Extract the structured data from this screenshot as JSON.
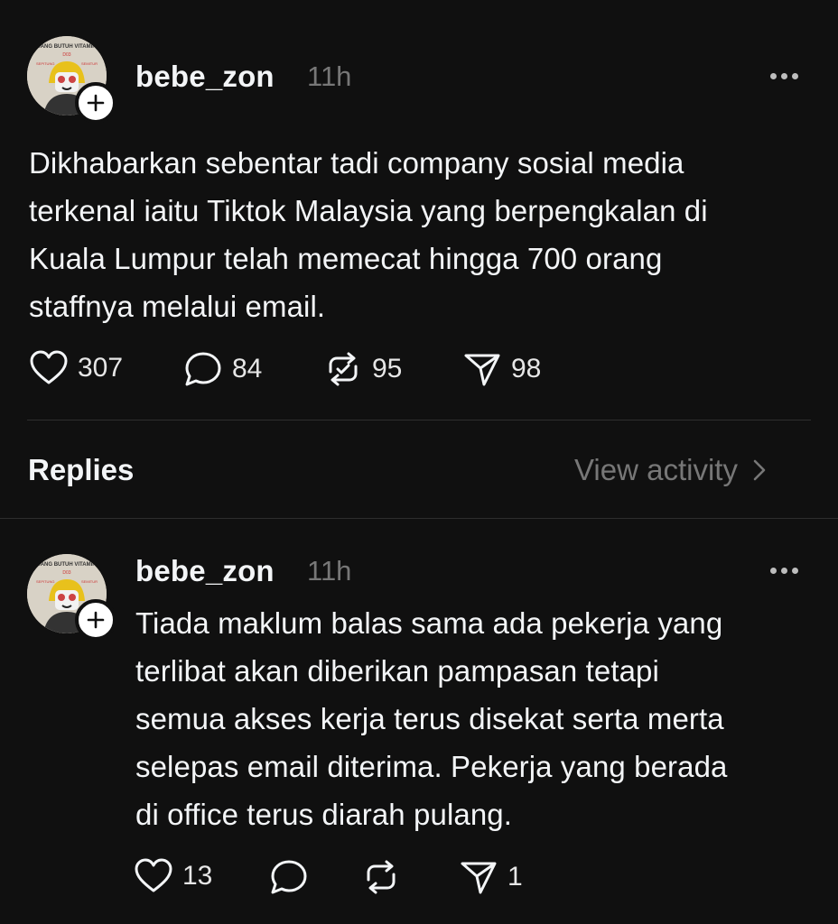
{
  "post": {
    "username": "bebe_zon",
    "time": "11h",
    "text_lines": [
      "Dikhabarkan sebentar tadi company sosial media",
      "terkenal iaitu Tiktok Malaysia yang berpengkalan di",
      "Kuala Lumpur telah memecat hingga 700 orang",
      "staffnya melalui email."
    ],
    "likes": "307",
    "comments": "84",
    "reposts": "95",
    "shares": "98"
  },
  "replies_header": {
    "title": "Replies",
    "view_activity": "View activity"
  },
  "reply": {
    "username": "bebe_zon",
    "time": "11h",
    "text_lines": [
      "Tiada maklum balas sama ada pekerja yang",
      "terlibat akan diberikan pampasan tetapi",
      "semua akses kerja terus disekat serta merta",
      "selepas email diterima. Pekerja yang berada",
      "di office terus diarah pulang."
    ],
    "likes": "13",
    "shares": "1"
  },
  "avatar_text": {
    "top": "JANG BUTUH VITAMIN",
    "mid": "D03",
    "left": "SEPITUNG",
    "right": "SEMITUR"
  },
  "icons": {
    "like": "heart-icon",
    "comment": "comment-icon",
    "repost": "repost-icon",
    "share": "send-icon",
    "more": "more-icon",
    "follow": "plus-icon",
    "chevron": "chevron-right-icon"
  }
}
